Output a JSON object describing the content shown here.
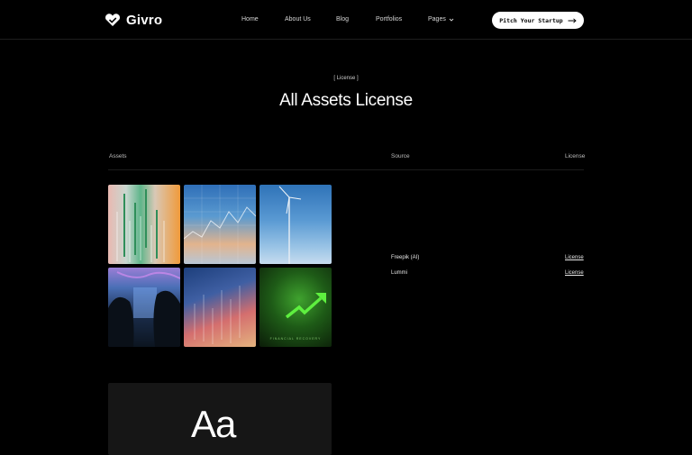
{
  "header": {
    "logo_text": "Givro",
    "nav": [
      {
        "label": "Home"
      },
      {
        "label": "About Us"
      },
      {
        "label": "Blog"
      },
      {
        "label": "Portfolios"
      },
      {
        "label": "Pages"
      }
    ],
    "cta_label": "Pitch Your Startup"
  },
  "hero": {
    "eyebrow": "[ License ]",
    "title": "All Assets License"
  },
  "table": {
    "columns": {
      "assets": "Assets",
      "source": "Source",
      "license": "License"
    },
    "rows": [
      {
        "source": "Freepik (AI)",
        "license": "License"
      },
      {
        "source": "Lummi",
        "license": "License"
      }
    ]
  },
  "thumbnails": {
    "financial_caption": "FINANCIAL RECOVERY"
  },
  "font_preview": {
    "sample": "Aa"
  },
  "colors": {
    "background": "#000000",
    "cta_background": "#ffffff",
    "accent_green": "#3fd12e"
  },
  "icons": {
    "logo": "heart-check-icon",
    "pages_dropdown": "chevron-down-icon",
    "cta_arrow": "arrow-right-icon"
  }
}
